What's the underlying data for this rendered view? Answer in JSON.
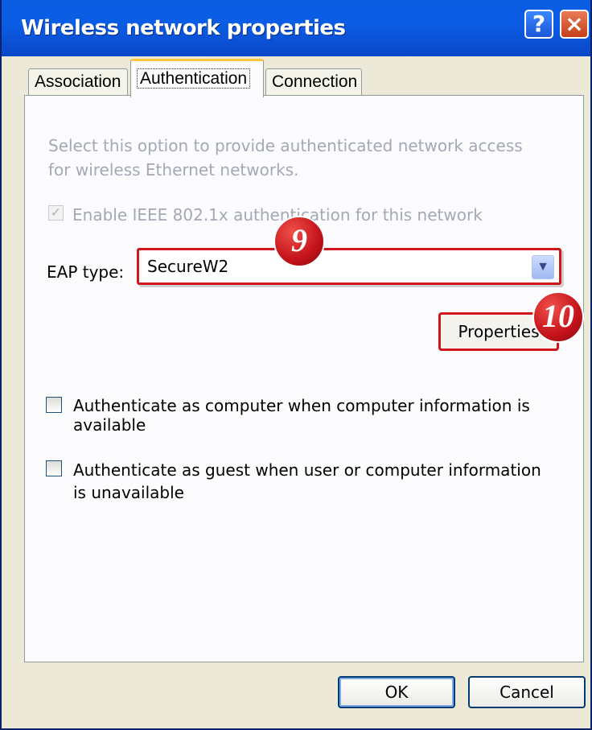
{
  "window": {
    "title": "Wireless network properties",
    "help": "?",
    "close": "×"
  },
  "tabs": [
    {
      "label": "Association"
    },
    {
      "label": "Authentication"
    },
    {
      "label": "Connection"
    }
  ],
  "auth": {
    "description": "Select this option to provide authenticated network access for wireless Ethernet networks.",
    "enable_label": "Enable IEEE 802.1x authentication for this network",
    "enable_checked": true,
    "enable_check_glyph": "✓",
    "eap_label": "EAP type:",
    "eap_value": "SecureW2",
    "eap_arrow": "▼",
    "properties_label": "Properties",
    "computer_label": "Authenticate as computer when computer information is available",
    "computer_checked": false,
    "guest_label": "Authenticate as guest when user or computer information is unavailable",
    "guest_checked": false
  },
  "callouts": {
    "step9": "9",
    "step10": "10"
  },
  "buttons": {
    "ok": "OK",
    "cancel": "Cancel"
  },
  "colors": {
    "title_blue": "#0b5de6",
    "callout_red": "#d2151a"
  }
}
